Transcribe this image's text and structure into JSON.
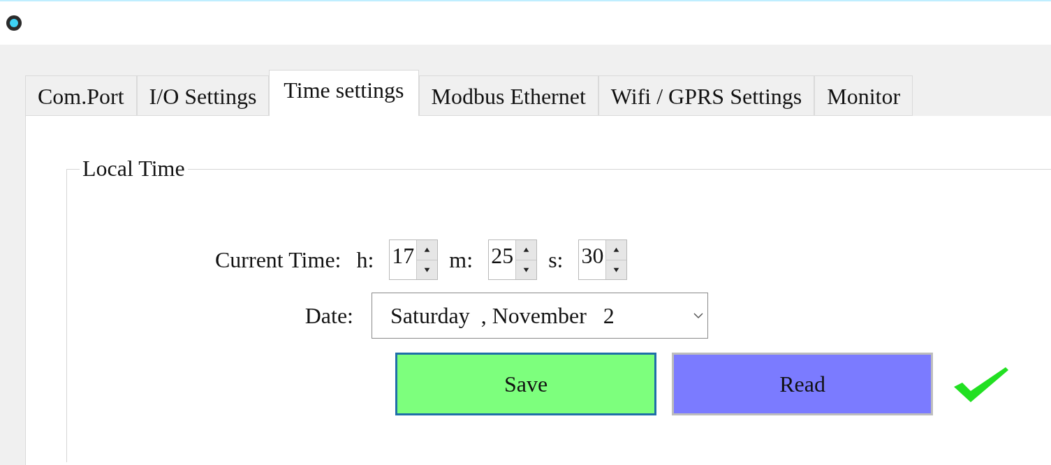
{
  "tabs": [
    {
      "label": "Com.Port",
      "selected": false
    },
    {
      "label": "I/O Settings",
      "selected": false
    },
    {
      "label": "Time settings",
      "selected": true
    },
    {
      "label": "Modbus Ethernet",
      "selected": false
    },
    {
      "label": "Wifi / GPRS Settings",
      "selected": false
    },
    {
      "label": "Monitor",
      "selected": false
    }
  ],
  "group": {
    "title": "Local Time",
    "current_time_label": "Current Time:",
    "spinners": [
      {
        "label": "h:",
        "value": "17"
      },
      {
        "label": "m:",
        "value": "25"
      },
      {
        "label": "s:",
        "value": "30"
      }
    ],
    "date_label": "Date:",
    "date": "Saturday  , November   2",
    "buttons": [
      {
        "label": "Save",
        "color": "#7dff7d",
        "focused": true
      },
      {
        "label": "Read",
        "color": "#7b7bff",
        "focused": false
      }
    ]
  }
}
